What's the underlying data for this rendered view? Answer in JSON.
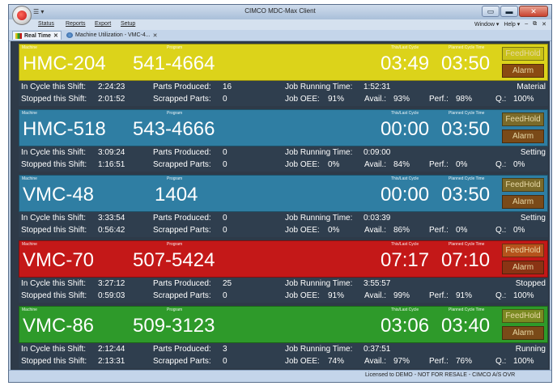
{
  "window": {
    "title": "CIMCO MDC-Max Client",
    "qat": "☰ ▾",
    "controls": {
      "minimize": "▭",
      "restore": "▬",
      "close": "✕"
    }
  },
  "menu": {
    "items": [
      "Status",
      "Reports",
      "Export",
      "Setup"
    ],
    "right": [
      "Window ▾",
      "Help ▾",
      "–",
      "⧉",
      "✕"
    ]
  },
  "tabs": [
    {
      "label": "Real Time",
      "close": "✕",
      "active": true
    },
    {
      "label": "Machine Utilization - VMC-4...",
      "close": "✕",
      "active": false
    }
  ],
  "labels": {
    "machine": "Machine",
    "program": "Program",
    "this_last_cycle": "This/Last Cycle",
    "planned_cycle": "Planned Cycle Time",
    "feedhold": "FeedHold",
    "alarm": "Alarm",
    "in_cycle": "In Cycle this Shift:",
    "stopped": "Stopped this Shift:",
    "parts_produced": "Parts Produced:",
    "scrapped": "Scrapped Parts:",
    "job_running": "Job Running Time:",
    "job_oee": "Job OEE:",
    "avail": "Avail.:",
    "perf": "Perf.:",
    "q": "Q.:"
  },
  "machines": [
    {
      "name": "HMC-204",
      "program": "541-4664",
      "cycle": "03:49",
      "planned": "03:50",
      "in_cycle": "2:24:23",
      "stopped": "2:01:52",
      "parts": "16",
      "scrapped": "0",
      "job_time": "1:52:31",
      "oee": "91%",
      "avail": "93%",
      "perf": "98%",
      "q": "100%",
      "status": "Material",
      "color": "#dcd31a",
      "button_color": "#c9c21b",
      "alarm_color": "#8a4a12"
    },
    {
      "name": "HMC-518",
      "program": "543-4666",
      "cycle": "00:00",
      "planned": "03:50",
      "in_cycle": "3:09:24",
      "stopped": "1:16:51",
      "parts": "0",
      "scrapped": "0",
      "job_time": "0:09:00",
      "oee": "0%",
      "avail": "84%",
      "perf": "0%",
      "q": "0%",
      "status": "Setting",
      "color": "#2f7ea3",
      "button_color": "#7a6a2a",
      "alarm_color": "#7a4a18"
    },
    {
      "name": "VMC-48",
      "program": "1404",
      "cycle": "00:00",
      "planned": "03:50",
      "in_cycle": "3:33:54",
      "stopped": "0:56:42",
      "parts": "0",
      "scrapped": "0",
      "job_time": "0:03:39",
      "oee": "0%",
      "avail": "86%",
      "perf": "0%",
      "q": "0%",
      "status": "Setting",
      "color": "#2f7ea3",
      "button_color": "#7a6a2a",
      "alarm_color": "#7a4a18"
    },
    {
      "name": "VMC-70",
      "program": "507-5424",
      "cycle": "07:17",
      "planned": "07:10",
      "in_cycle": "3:27:12",
      "stopped": "0:59:03",
      "parts": "25",
      "scrapped": "0",
      "job_time": "3:55:57",
      "oee": "91%",
      "avail": "99%",
      "perf": "91%",
      "q": "100%",
      "status": "Stopped",
      "color": "#c41818",
      "button_color": "#b5531c",
      "alarm_color": "#8a3414"
    },
    {
      "name": "VMC-86",
      "program": "509-3123",
      "cycle": "03:06",
      "planned": "03:40",
      "in_cycle": "2:12:44",
      "stopped": "2:13:31",
      "parts": "3",
      "scrapped": "0",
      "job_time": "0:37:51",
      "oee": "74%",
      "avail": "97%",
      "perf": "76%",
      "q": "100%",
      "status": "Running",
      "color": "#2e9a2a",
      "button_color": "#7a8a22",
      "alarm_color": "#7a4a18"
    }
  ],
  "statusbar": {
    "license": "Licensed to DEMO - NOT FOR RESALE - CIMCO A/S",
    "mode": "OVR"
  }
}
